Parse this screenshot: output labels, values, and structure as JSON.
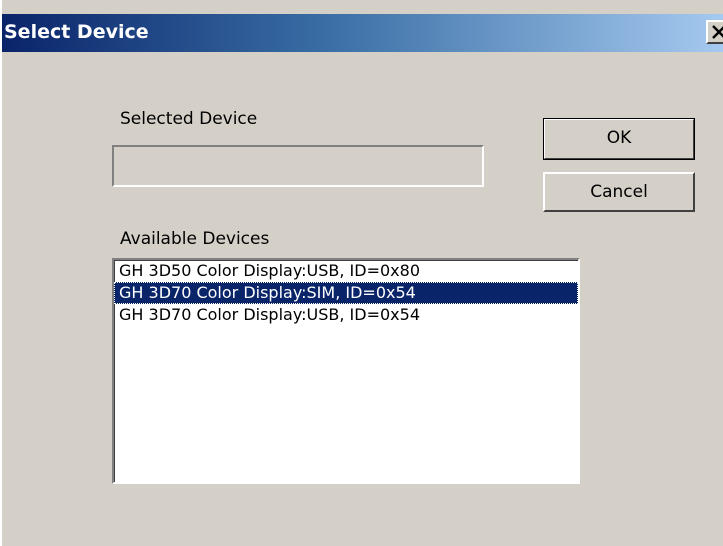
{
  "window": {
    "title": "Select Device",
    "close_glyph": "close-icon"
  },
  "selected_device": {
    "label": "Selected Device",
    "value": ""
  },
  "buttons": {
    "ok_label": "OK",
    "cancel_label": "Cancel"
  },
  "available_devices": {
    "label": "Available Devices",
    "items": [
      {
        "text": "GH 3D50 Color Display:USB, ID=0x80",
        "selected": false
      },
      {
        "text": "GH 3D70 Color Display:SIM, ID=0x54",
        "selected": true
      },
      {
        "text": "GH 3D70 Color Display:USB, ID=0x54",
        "selected": false
      }
    ]
  },
  "colors": {
    "titlebar_start": "#0a246a",
    "titlebar_end": "#a6caf0",
    "selection": "#0a246a",
    "face": "#d4d0c8"
  }
}
